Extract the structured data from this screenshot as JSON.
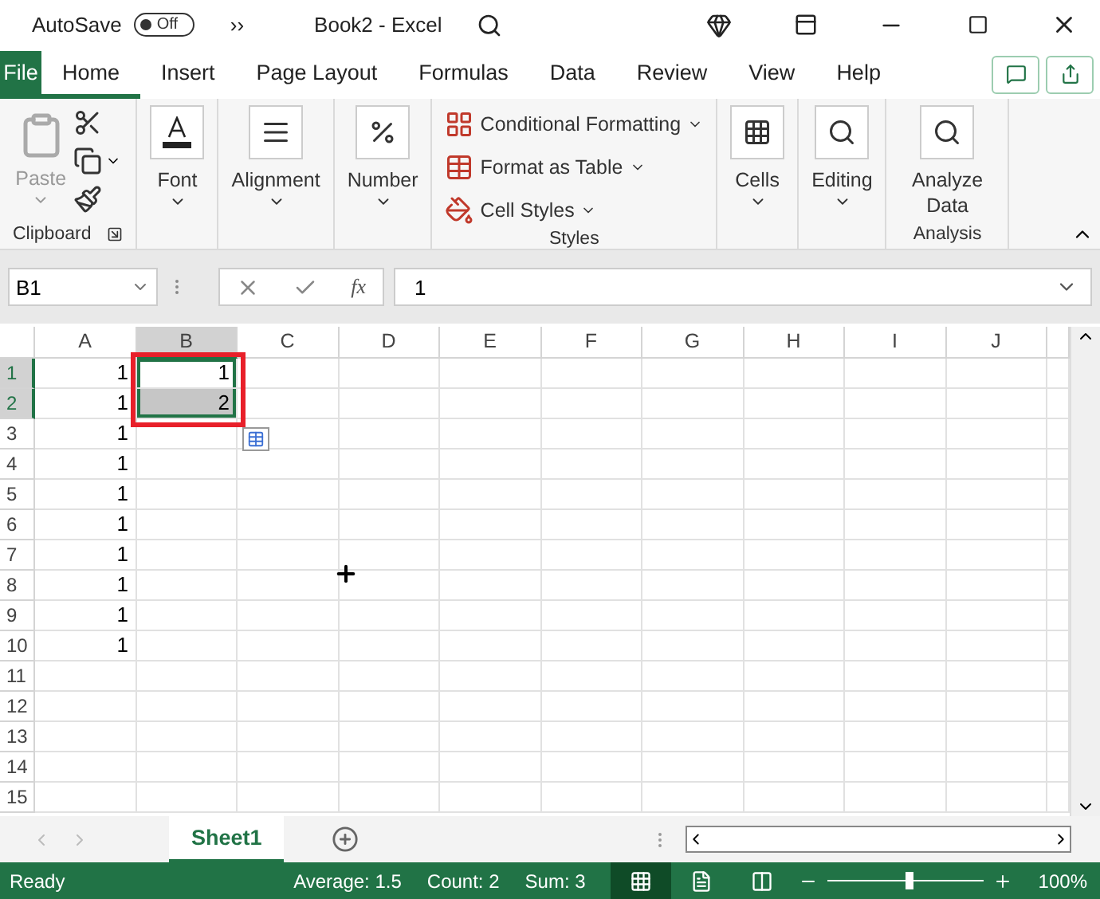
{
  "title_bar": {
    "autosave_label": "AutoSave",
    "autosave_toggle": {
      "label": "Off",
      "on": false
    },
    "overflow": "››",
    "document_title": "Book2  -  Excel"
  },
  "ribbon_tabs": [
    {
      "label": "File",
      "kind": "file",
      "selected": false
    },
    {
      "label": "Home",
      "kind": "tab",
      "selected": true
    },
    {
      "label": "Insert",
      "kind": "tab",
      "selected": false
    },
    {
      "label": "Page Layout",
      "kind": "tab",
      "selected": false
    },
    {
      "label": "Formulas",
      "kind": "tab",
      "selected": false
    },
    {
      "label": "Data",
      "kind": "tab",
      "selected": false
    },
    {
      "label": "Review",
      "kind": "tab",
      "selected": false
    },
    {
      "label": "View",
      "kind": "tab",
      "selected": false
    },
    {
      "label": "Help",
      "kind": "tab",
      "selected": false
    }
  ],
  "ribbon_groups": [
    {
      "label": "Clipboard",
      "launcher": true,
      "items": [
        {
          "kind": "large",
          "label": "Paste",
          "disabled": true,
          "dropdown": true
        },
        {
          "kind": "small",
          "dropdown": false
        },
        {
          "kind": "small",
          "dropdown": true
        },
        {
          "kind": "small",
          "dropdown": false
        }
      ]
    },
    {
      "items": [
        {
          "kind": "large",
          "label": "Font",
          "dropdown": true
        }
      ]
    },
    {
      "items": [
        {
          "kind": "large",
          "label": "Alignment",
          "dropdown": true
        }
      ]
    },
    {
      "items": [
        {
          "kind": "large",
          "label": "Number",
          "dropdown": true
        }
      ]
    },
    {
      "label": "Styles",
      "items": [
        {
          "kind": "row",
          "label": "Conditional Formatting",
          "dropdown": true
        },
        {
          "kind": "row",
          "label": "Format as Table",
          "dropdown": true
        },
        {
          "kind": "row",
          "label": "Cell Styles",
          "dropdown": true
        }
      ]
    },
    {
      "items": [
        {
          "kind": "large",
          "label": "Cells",
          "dropdown": true
        }
      ]
    },
    {
      "items": [
        {
          "kind": "large",
          "label": "Editing",
          "dropdown": true
        }
      ]
    },
    {
      "label": "Analysis",
      "items": [
        {
          "kind": "large",
          "label": "Analyze Data",
          "dropdown": false
        }
      ]
    }
  ],
  "formula_bar": {
    "name_box": "B1",
    "function_label": "fx",
    "formula": "1"
  },
  "columns": [
    {
      "label": "A",
      "selected": false
    },
    {
      "label": "B",
      "selected": true
    },
    {
      "label": "C",
      "selected": false
    },
    {
      "label": "D",
      "selected": false
    },
    {
      "label": "E",
      "selected": false
    },
    {
      "label": "F",
      "selected": false
    },
    {
      "label": "G",
      "selected": false
    },
    {
      "label": "H",
      "selected": false
    },
    {
      "label": "I",
      "selected": false
    },
    {
      "label": "J",
      "selected": false
    }
  ],
  "rows": [
    {
      "label": "1",
      "selected": true,
      "cells": [
        {
          "value": "1",
          "selected": false
        },
        {
          "value": "1",
          "selected": true,
          "active": true
        }
      ]
    },
    {
      "label": "2",
      "selected": true,
      "cells": [
        {
          "value": "1",
          "selected": false
        },
        {
          "value": "2",
          "selected": true
        }
      ]
    },
    {
      "label": "3",
      "selected": false,
      "cells": [
        {
          "value": "1",
          "selected": false
        }
      ]
    },
    {
      "label": "4",
      "selected": false,
      "cells": [
        {
          "value": "1",
          "selected": false
        }
      ]
    },
    {
      "label": "5",
      "selected": false,
      "cells": [
        {
          "value": "1",
          "selected": false
        }
      ]
    },
    {
      "label": "6",
      "selected": false,
      "cells": [
        {
          "value": "1",
          "selected": false
        }
      ]
    },
    {
      "label": "7",
      "selected": false,
      "cells": [
        {
          "value": "1",
          "selected": false
        }
      ]
    },
    {
      "label": "8",
      "selected": false,
      "cells": [
        {
          "value": "1",
          "selected": false
        }
      ]
    },
    {
      "label": "9",
      "selected": false,
      "cells": [
        {
          "value": "1",
          "selected": false
        }
      ]
    },
    {
      "label": "10",
      "selected": false,
      "cells": [
        {
          "value": "1",
          "selected": false
        }
      ]
    },
    {
      "label": "11",
      "selected": false,
      "cells": []
    },
    {
      "label": "12",
      "selected": false,
      "cells": []
    },
    {
      "label": "13",
      "selected": false,
      "cells": []
    },
    {
      "label": "14",
      "selected": false,
      "cells": []
    },
    {
      "label": "15",
      "selected": false,
      "cells": []
    }
  ],
  "sheet_tabs": [
    {
      "label": "Sheet1",
      "selected": true
    }
  ],
  "status_bar": {
    "status": "Ready",
    "stats": [
      "Average: 1.5",
      "Count: 2",
      "Sum: 3"
    ],
    "views": [
      {
        "selected": true
      },
      {
        "selected": false
      },
      {
        "selected": false
      }
    ],
    "zoom": {
      "level": 0.52,
      "reading": "100%"
    }
  }
}
